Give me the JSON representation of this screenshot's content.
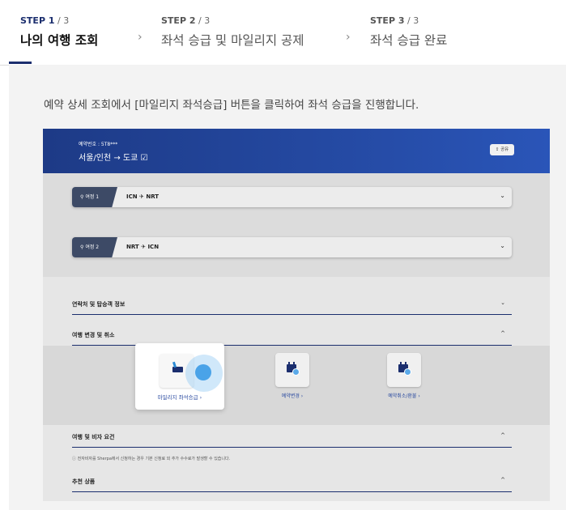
{
  "steps": [
    {
      "num": "STEP 1",
      "total": " / 3",
      "title": "나의 여행 조회"
    },
    {
      "num": "STEP 2",
      "total": " / 3",
      "title": "좌석 승급 및 마일리지 공제"
    },
    {
      "num": "STEP 3",
      "total": " / 3",
      "title": "좌석 승급 완료"
    }
  ],
  "step_separator": "›",
  "description": "예약 상세 조회에서 [마일리지 좌석승급] 버튼을 클릭하여 좌석 승급을 진행합니다.",
  "mock": {
    "reservation_number": "예약번호 : 5T8***",
    "route": "서울/인천 → 도쿄 ☑",
    "share_label": "⇪ 공유",
    "trips": [
      {
        "badge": "여정 1",
        "route": "ICN ✈ NRT",
        "toggle": "⌄"
      },
      {
        "badge": "여정 2",
        "route": "NRT ✈ ICN",
        "toggle": "⌄"
      }
    ],
    "sections": {
      "contact": {
        "label": "연락처 및 탑승객 정보",
        "toggle": "⌄"
      },
      "change": {
        "label": "여행 변경 및 취소",
        "toggle": "^"
      },
      "visa": {
        "label": "여행 및 비자 요건",
        "toggle": "^"
      },
      "recommend": {
        "label": "추천 상품",
        "toggle": "^"
      }
    },
    "options": {
      "upgrade": "마일리지 좌석승급 ›",
      "change": "예약변경 ›",
      "cancel": "예약취소/환불 ›"
    },
    "notice": "ⓘ 전자비자를 Sherpa에서 신청하는 경우 기본 신청료 외 추가 수수료가 발생할 수 있습니다."
  },
  "colors": {
    "brand_navy": "#1b2e6e",
    "header_blue": "#2a55b8",
    "tap_blue": "#4aa3e8"
  }
}
